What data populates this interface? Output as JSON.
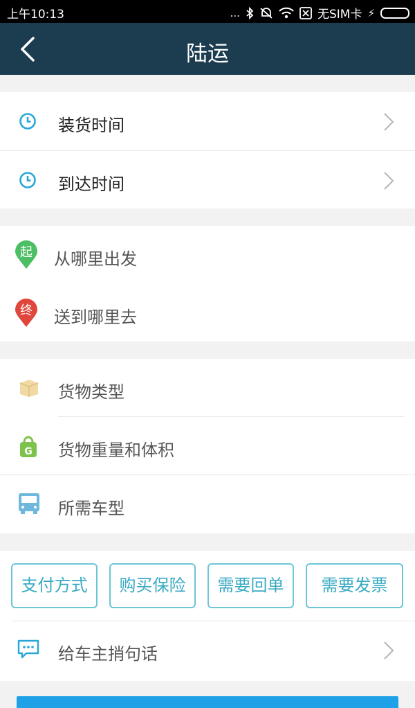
{
  "status": {
    "time": "上午10:13",
    "dots": "...",
    "sim": "无SIM卡",
    "charge": "⚡"
  },
  "header": {
    "title": "陆运"
  },
  "time_section": {
    "loading": "装货时间",
    "arrival": "到达时间"
  },
  "route_section": {
    "from_marker": "起",
    "from_label": "从哪里出发",
    "to_marker": "终",
    "to_label": "送到哪里去"
  },
  "cargo_section": {
    "type_label": "货物类型",
    "weight_icon_letter": "G",
    "weight_label": "货物重量和体积",
    "vehicle_label": "所需车型"
  },
  "options": {
    "buttons": [
      "支付方式",
      "购买保险",
      "需要回单",
      "需要发票"
    ],
    "message_label": "给车主捎句话"
  },
  "colors": {
    "nav": "#1c3c50",
    "accent": "#39aac3",
    "clock": "#27a7d8",
    "start_marker": "#4cbe63",
    "end_marker": "#e0463b",
    "submit": "#1ea1e6"
  }
}
